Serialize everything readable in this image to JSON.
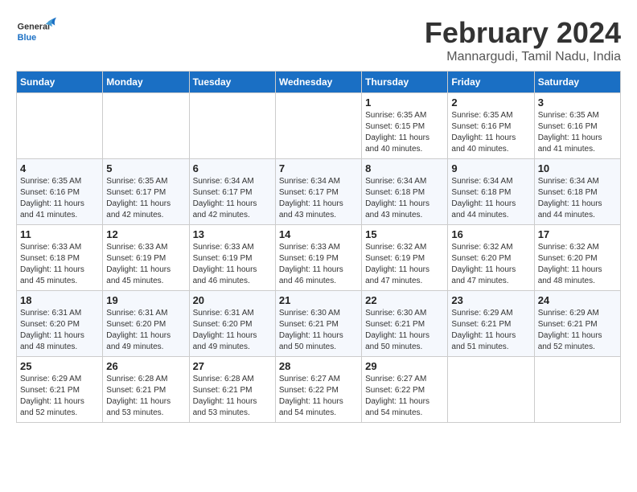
{
  "header": {
    "logo_general": "General",
    "logo_blue": "Blue",
    "title": "February 2024",
    "subtitle": "Mannargudi, Tamil Nadu, India"
  },
  "weekdays": [
    "Sunday",
    "Monday",
    "Tuesday",
    "Wednesday",
    "Thursday",
    "Friday",
    "Saturday"
  ],
  "weeks": [
    [
      {
        "day": "",
        "empty": true
      },
      {
        "day": "",
        "empty": true
      },
      {
        "day": "",
        "empty": true
      },
      {
        "day": "",
        "empty": true
      },
      {
        "day": "1",
        "sunrise": "6:35 AM",
        "sunset": "6:15 PM",
        "daylight": "11 hours and 40 minutes."
      },
      {
        "day": "2",
        "sunrise": "6:35 AM",
        "sunset": "6:16 PM",
        "daylight": "11 hours and 40 minutes."
      },
      {
        "day": "3",
        "sunrise": "6:35 AM",
        "sunset": "6:16 PM",
        "daylight": "11 hours and 41 minutes."
      }
    ],
    [
      {
        "day": "4",
        "sunrise": "6:35 AM",
        "sunset": "6:16 PM",
        "daylight": "11 hours and 41 minutes."
      },
      {
        "day": "5",
        "sunrise": "6:35 AM",
        "sunset": "6:17 PM",
        "daylight": "11 hours and 42 minutes."
      },
      {
        "day": "6",
        "sunrise": "6:34 AM",
        "sunset": "6:17 PM",
        "daylight": "11 hours and 42 minutes."
      },
      {
        "day": "7",
        "sunrise": "6:34 AM",
        "sunset": "6:17 PM",
        "daylight": "11 hours and 43 minutes."
      },
      {
        "day": "8",
        "sunrise": "6:34 AM",
        "sunset": "6:18 PM",
        "daylight": "11 hours and 43 minutes."
      },
      {
        "day": "9",
        "sunrise": "6:34 AM",
        "sunset": "6:18 PM",
        "daylight": "11 hours and 44 minutes."
      },
      {
        "day": "10",
        "sunrise": "6:34 AM",
        "sunset": "6:18 PM",
        "daylight": "11 hours and 44 minutes."
      }
    ],
    [
      {
        "day": "11",
        "sunrise": "6:33 AM",
        "sunset": "6:18 PM",
        "daylight": "11 hours and 45 minutes."
      },
      {
        "day": "12",
        "sunrise": "6:33 AM",
        "sunset": "6:19 PM",
        "daylight": "11 hours and 45 minutes."
      },
      {
        "day": "13",
        "sunrise": "6:33 AM",
        "sunset": "6:19 PM",
        "daylight": "11 hours and 46 minutes."
      },
      {
        "day": "14",
        "sunrise": "6:33 AM",
        "sunset": "6:19 PM",
        "daylight": "11 hours and 46 minutes."
      },
      {
        "day": "15",
        "sunrise": "6:32 AM",
        "sunset": "6:19 PM",
        "daylight": "11 hours and 47 minutes."
      },
      {
        "day": "16",
        "sunrise": "6:32 AM",
        "sunset": "6:20 PM",
        "daylight": "11 hours and 47 minutes."
      },
      {
        "day": "17",
        "sunrise": "6:32 AM",
        "sunset": "6:20 PM",
        "daylight": "11 hours and 48 minutes."
      }
    ],
    [
      {
        "day": "18",
        "sunrise": "6:31 AM",
        "sunset": "6:20 PM",
        "daylight": "11 hours and 48 minutes."
      },
      {
        "day": "19",
        "sunrise": "6:31 AM",
        "sunset": "6:20 PM",
        "daylight": "11 hours and 49 minutes."
      },
      {
        "day": "20",
        "sunrise": "6:31 AM",
        "sunset": "6:20 PM",
        "daylight": "11 hours and 49 minutes."
      },
      {
        "day": "21",
        "sunrise": "6:30 AM",
        "sunset": "6:21 PM",
        "daylight": "11 hours and 50 minutes."
      },
      {
        "day": "22",
        "sunrise": "6:30 AM",
        "sunset": "6:21 PM",
        "daylight": "11 hours and 50 minutes."
      },
      {
        "day": "23",
        "sunrise": "6:29 AM",
        "sunset": "6:21 PM",
        "daylight": "11 hours and 51 minutes."
      },
      {
        "day": "24",
        "sunrise": "6:29 AM",
        "sunset": "6:21 PM",
        "daylight": "11 hours and 52 minutes."
      }
    ],
    [
      {
        "day": "25",
        "sunrise": "6:29 AM",
        "sunset": "6:21 PM",
        "daylight": "11 hours and 52 minutes."
      },
      {
        "day": "26",
        "sunrise": "6:28 AM",
        "sunset": "6:21 PM",
        "daylight": "11 hours and 53 minutes."
      },
      {
        "day": "27",
        "sunrise": "6:28 AM",
        "sunset": "6:21 PM",
        "daylight": "11 hours and 53 minutes."
      },
      {
        "day": "28",
        "sunrise": "6:27 AM",
        "sunset": "6:22 PM",
        "daylight": "11 hours and 54 minutes."
      },
      {
        "day": "29",
        "sunrise": "6:27 AM",
        "sunset": "6:22 PM",
        "daylight": "11 hours and 54 minutes."
      },
      {
        "day": "",
        "empty": true
      },
      {
        "day": "",
        "empty": true
      }
    ]
  ]
}
